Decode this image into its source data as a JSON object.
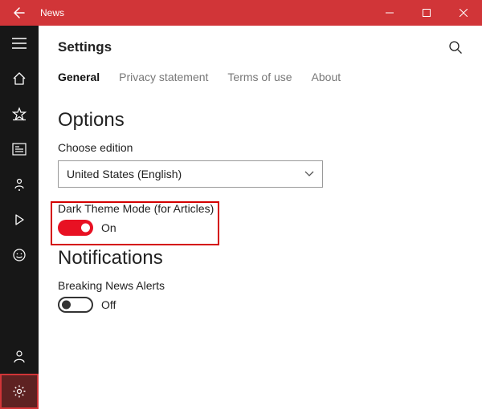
{
  "titlebar": {
    "app_title": "News"
  },
  "colors": {
    "accent": "#d13538",
    "toggle_on": "#e81123"
  },
  "header": {
    "title": "Settings"
  },
  "tabs": [
    {
      "label": "General",
      "active": true
    },
    {
      "label": "Privacy statement",
      "active": false
    },
    {
      "label": "Terms of use",
      "active": false
    },
    {
      "label": "About",
      "active": false
    }
  ],
  "options": {
    "heading": "Options",
    "choose_edition_label": "Choose edition",
    "edition_value": "United States (English)",
    "dark_theme": {
      "label": "Dark Theme Mode (for Articles)",
      "state_text": "On",
      "on": true
    }
  },
  "notifications": {
    "heading": "Notifications",
    "breaking_news": {
      "label": "Breaking News Alerts",
      "state_text": "Off",
      "on": false
    }
  }
}
